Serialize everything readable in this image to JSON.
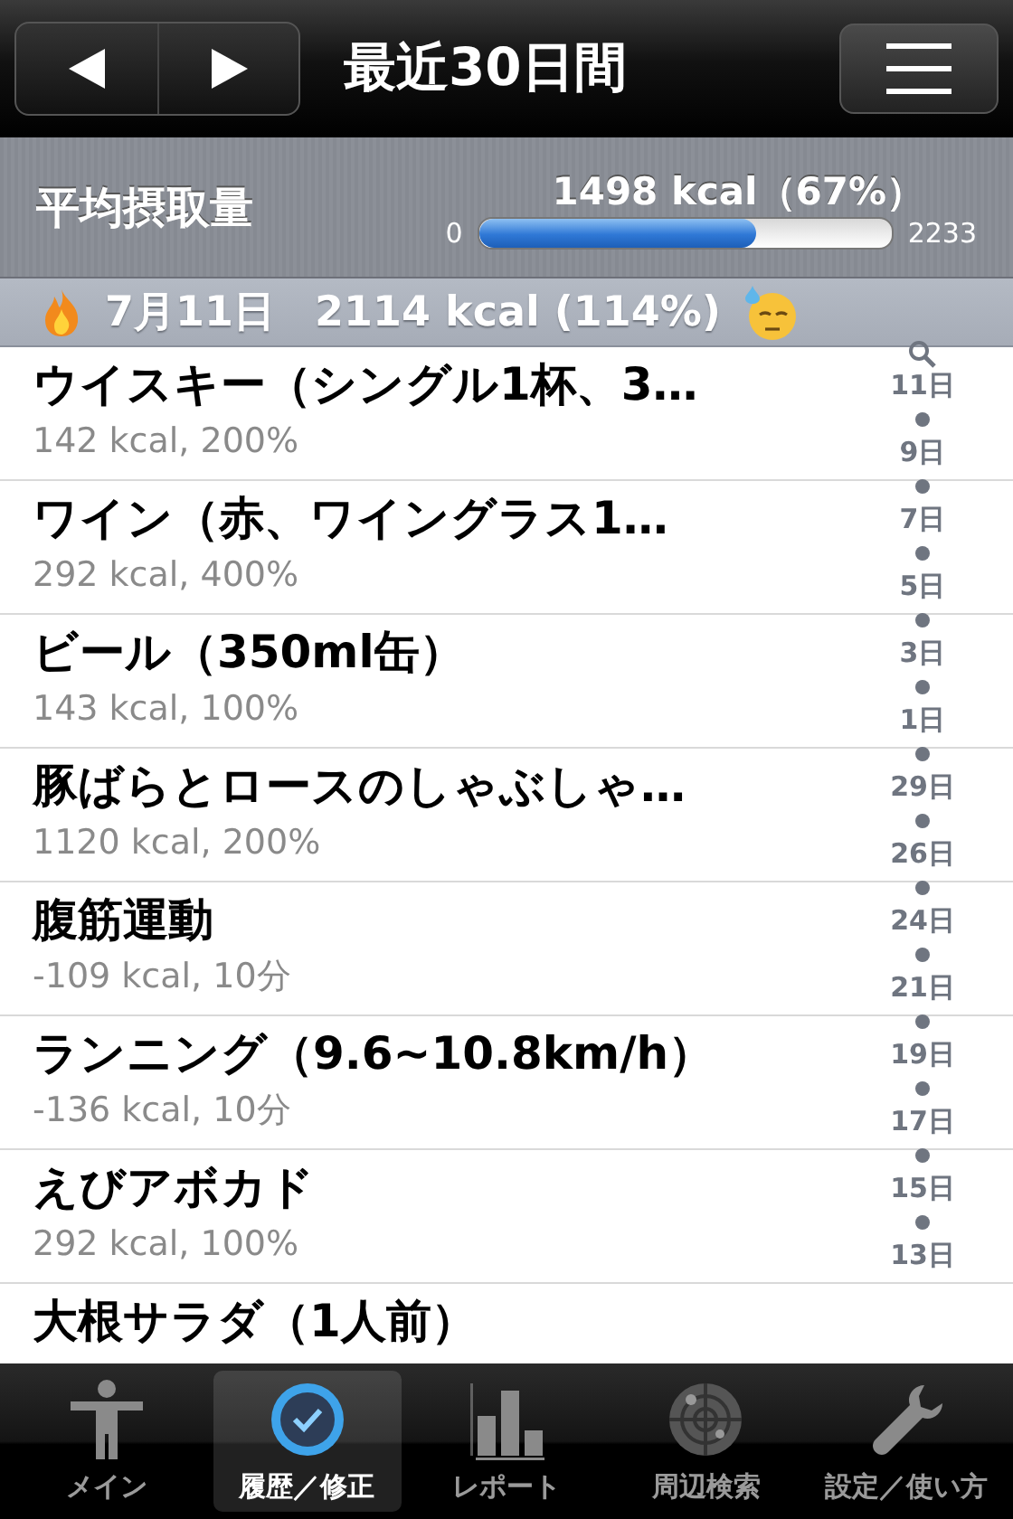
{
  "nav": {
    "title": "最近30日間"
  },
  "summary": {
    "label": "平均摂取量",
    "value": "1498 kcal（67%）",
    "min": "0",
    "max": "2233",
    "level": 0.67
  },
  "section": {
    "date": "7月11日",
    "total": "2114 kcal (114%)"
  },
  "entries": [
    {
      "name": "ウイスキー（シングル1杯、3…",
      "detail": "142 kcal, 200%"
    },
    {
      "name": "ワイン（赤、ワイングラス1…",
      "detail": "292 kcal, 400%"
    },
    {
      "name": "ビール（350ml缶）",
      "detail": "143 kcal, 100%"
    },
    {
      "name": "豚ばらとロースのしゃぶしゃ…",
      "detail": "1120 kcal, 200%"
    },
    {
      "name": "腹筋運動",
      "detail": "-109 kcal, 10分"
    },
    {
      "name": "ランニング（9.6~10.8km/h）",
      "detail": "-136 kcal, 10分"
    },
    {
      "name": "えびアボカド",
      "detail": "292 kcal, 100%"
    },
    {
      "name": "大根サラダ（1人前）"
    }
  ],
  "index": [
    "11日",
    "9日",
    "7日",
    "5日",
    "3日",
    "1日",
    "29日",
    "26日",
    "24日",
    "21日",
    "19日",
    "17日",
    "15日",
    "13日"
  ],
  "tabs": [
    {
      "label": "メイン",
      "selected": false
    },
    {
      "label": "履歴／修正",
      "selected": true
    },
    {
      "label": "レポート",
      "selected": false
    },
    {
      "label": "周辺検索",
      "selected": false
    },
    {
      "label": "設定／使い方",
      "selected": false
    }
  ]
}
